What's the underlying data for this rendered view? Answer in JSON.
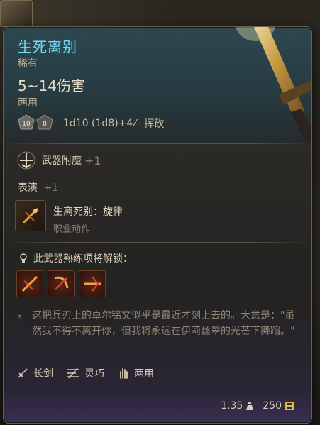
{
  "item": {
    "name": "生死离别",
    "rarity": "稀有",
    "damage": "5~14伤害",
    "hands": "两用",
    "dice_left": "10",
    "dice_right": "8",
    "damage_formula": "1d10 (1d8)+4",
    "damage_type": "挥砍"
  },
  "bonuses": {
    "enchant_label": "武器附魔",
    "enchant_value": "+1",
    "perform_label": "表演",
    "perform_value": "+1"
  },
  "action": {
    "name": "生离死别：旋律",
    "category": "职业动作"
  },
  "proficiency": {
    "unlock_label": "此武器熟练项将解锁："
  },
  "lore": "这把兵刃上的卓尔铭文似乎是最近才刻上去的。大意是：\"虽然我不得不离开你，但我将永远在伊莉丝翠的光芒下舞蹈。\"",
  "properties": [
    {
      "label": "长剑",
      "icon": "sword-icon"
    },
    {
      "label": "灵巧",
      "icon": "finesse-icon"
    },
    {
      "label": "两用",
      "icon": "hand-icon"
    }
  ],
  "weight": "1.35",
  "value": "250",
  "colors": {
    "title": "#7fd4ec",
    "text": "#d8ccb5",
    "muted": "#908676"
  }
}
